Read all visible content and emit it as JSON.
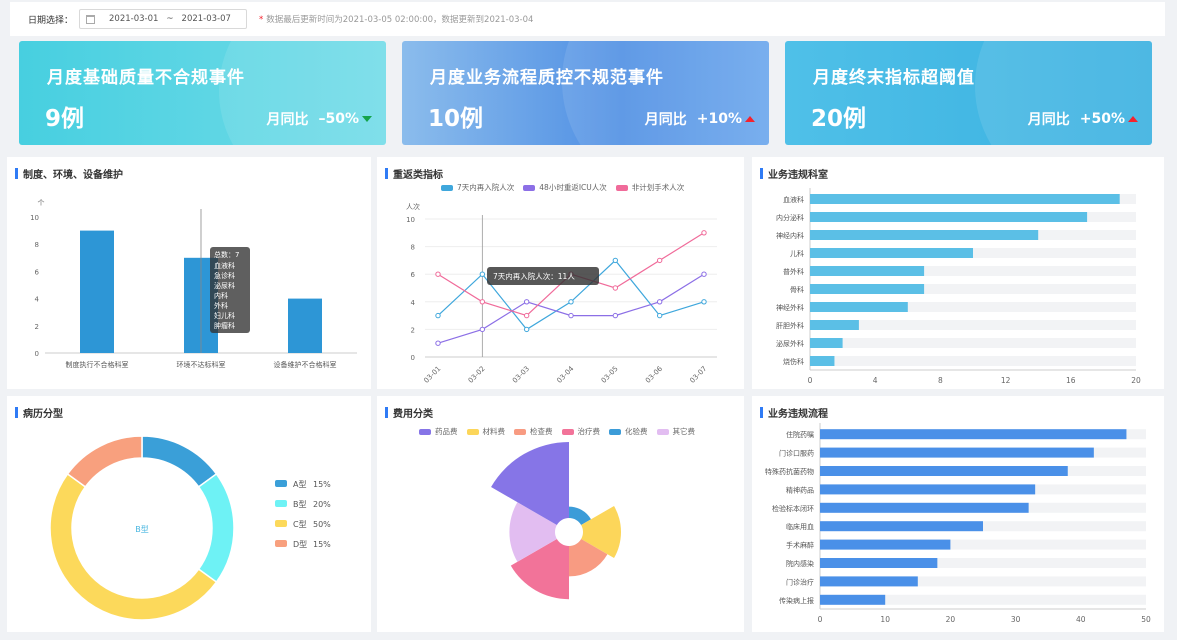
{
  "filter": {
    "label": "日期选择：",
    "start": "2021-03-01",
    "sep": "~",
    "end": "2021-03-07",
    "notice": "数据最后更新时间为2021-03-05 02:00:00，数据更新到2021-03-04"
  },
  "cards": [
    {
      "title": "月度基础质量不合规事件",
      "value": "9例",
      "cmp_label": "月同比",
      "cmp_value": "–50%",
      "trend": "down"
    },
    {
      "title": "月度业务流程质控不规范事件",
      "value": "10例",
      "cmp_label": "月同比",
      "cmp_value": "+10%",
      "trend": "up"
    },
    {
      "title": "月度终末指标超阈值",
      "value": "20例",
      "cmp_label": "月同比",
      "cmp_value": "+50%",
      "trend": "up"
    }
  ],
  "panels": {
    "p1": "制度、环境、设备维护",
    "p2": "重返类指标",
    "p3": "业务违规科室",
    "p4": "病历分型",
    "p5": "费用分类",
    "p6": "业务违规流程"
  },
  "chart_data": [
    {
      "type": "bar",
      "title": "制度、环境、设备维护",
      "ylabel": "个",
      "categories": [
        "制度执行不合格科室",
        "环境不达标科室",
        "设备维护不合格科室"
      ],
      "values": [
        9,
        7,
        4
      ],
      "ylim": [
        0,
        10
      ],
      "yticks": [
        0,
        2,
        4,
        6,
        8,
        10
      ],
      "tooltip": {
        "header": "总数：7",
        "lines": [
          "血液科",
          "急诊科",
          "泌尿科",
          "内科",
          "外科",
          "妇儿科",
          "肿瘤科"
        ]
      }
    },
    {
      "type": "line",
      "title": "重返类指标",
      "ylabel": "人次",
      "x": [
        "03-01",
        "03-02",
        "03-03",
        "03-04",
        "03-05",
        "03-06",
        "03-07"
      ],
      "ylim": [
        0,
        10
      ],
      "yticks": [
        0,
        2,
        4,
        6,
        8,
        10
      ],
      "series": [
        {
          "name": "7天内再入院人次",
          "color": "#3fa7dc",
          "values": [
            3,
            6,
            2,
            4,
            7,
            3,
            4
          ]
        },
        {
          "name": "48小时重返ICU人次",
          "color": "#8c6fe6",
          "values": [
            1,
            2,
            4,
            3,
            3,
            4,
            6
          ]
        },
        {
          "name": "非计划手术人次",
          "color": "#f06b9a",
          "values": [
            6,
            4,
            3,
            6,
            5,
            7,
            9
          ]
        }
      ],
      "tooltip": "7天内再入院人次：11人"
    },
    {
      "type": "bar",
      "orientation": "horizontal",
      "title": "业务违规科室",
      "categories": [
        "血液科",
        "内分泌科",
        "神经内科",
        "儿科",
        "普外科",
        "骨科",
        "神经外科",
        "肝胆外科",
        "泌尿外科",
        "烧伤科"
      ],
      "values": [
        19,
        17,
        14,
        10,
        7,
        7,
        6,
        3,
        2,
        1.5
      ],
      "xlim": [
        0,
        20
      ],
      "xticks": [
        0,
        4,
        8,
        12,
        16,
        20
      ]
    },
    {
      "type": "pie",
      "title": "病历分型",
      "center_label": "B型",
      "slices": [
        {
          "name": "A型",
          "value": 15,
          "label": "15%",
          "color": "#3a9fd8"
        },
        {
          "name": "B型",
          "value": 20,
          "label": "20%",
          "color": "#6ef2f5"
        },
        {
          "name": "C型",
          "value": 50,
          "label": "50%",
          "color": "#fcd95b"
        },
        {
          "name": "D型",
          "value": 15,
          "label": "15%",
          "color": "#f8a07e"
        }
      ]
    },
    {
      "type": "pie",
      "subtype": "rose",
      "title": "费用分类",
      "slices": [
        {
          "name": "药品费",
          "value": 10,
          "color": "#8675e7"
        },
        {
          "name": "材料费",
          "value": 5,
          "color": "#fcd65a"
        },
        {
          "name": "检查费",
          "value": 4,
          "color": "#f89b82"
        },
        {
          "name": "治疗费",
          "value": 7,
          "color": "#f27399"
        },
        {
          "name": "化验费",
          "value": 1.5,
          "color": "#3c9cd8"
        },
        {
          "name": "其它费",
          "value": 6,
          "color": "#e2bdf1"
        }
      ]
    },
    {
      "type": "bar",
      "orientation": "horizontal",
      "title": "业务违规流程",
      "categories": [
        "住院药嘱",
        "门诊口服药",
        "特殊药抗菌药物",
        "精神药品",
        "检验标本闭环",
        "临床用血",
        "手术麻醉",
        "院内感染",
        "门诊治疗",
        "传染病上报"
      ],
      "values": [
        47,
        42,
        38,
        33,
        32,
        25,
        20,
        18,
        15,
        10
      ],
      "xlim": [
        0,
        50
      ],
      "xticks": [
        0,
        10,
        20,
        30,
        40,
        50
      ]
    }
  ]
}
